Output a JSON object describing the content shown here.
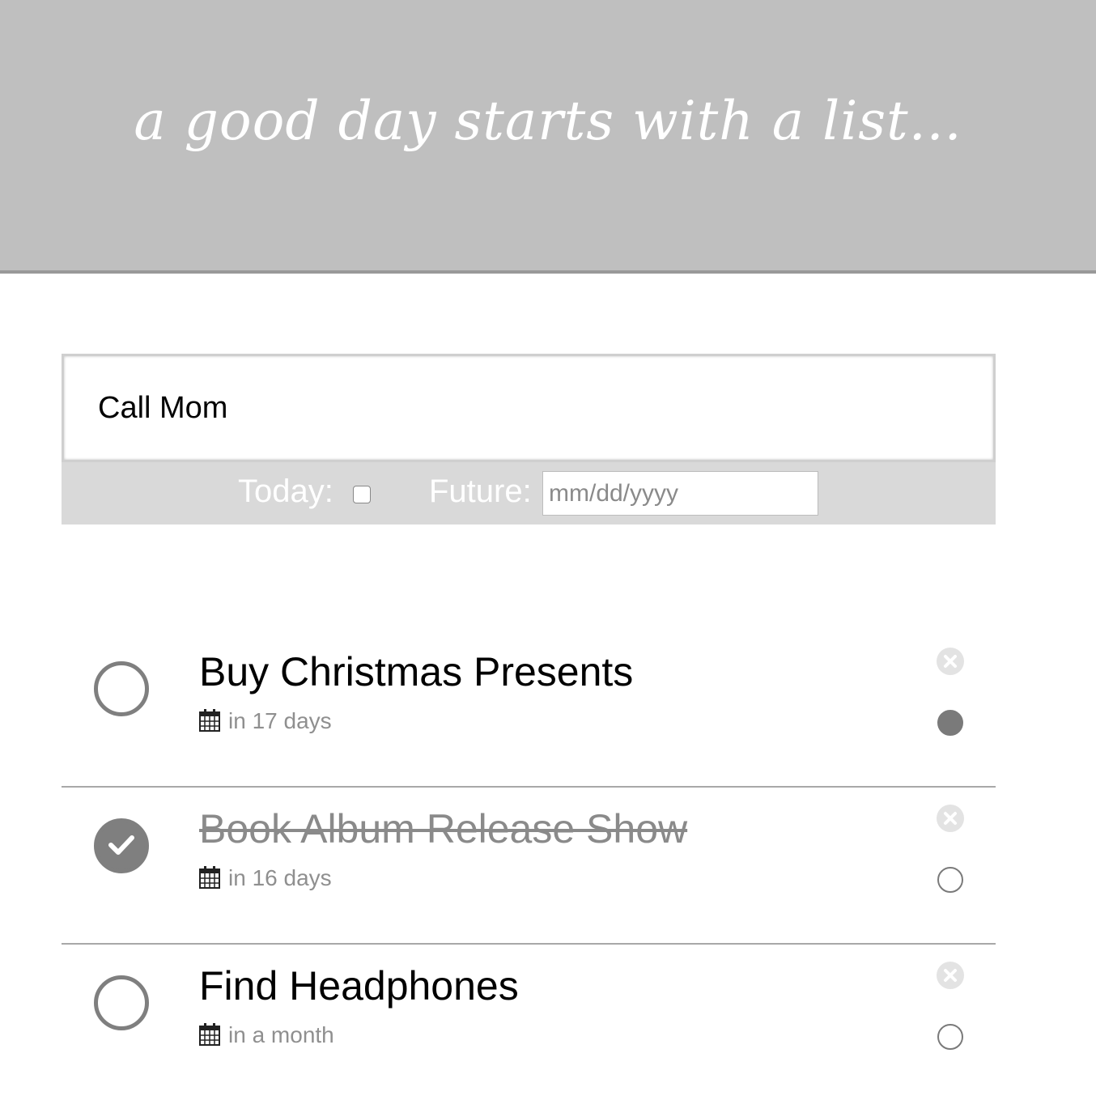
{
  "header": {
    "tagline": "a good day starts with a list..."
  },
  "entry": {
    "value": "Call Mom"
  },
  "options": {
    "today_label": "Today:",
    "today_checked": false,
    "future_label": "Future:",
    "date_placeholder": "mm/dd/yyyy"
  },
  "tasks": [
    {
      "title": "Buy Christmas Presents",
      "due": "in 17 days",
      "completed": false,
      "priority": true
    },
    {
      "title": "Book Album Release Show",
      "due": "in 16 days",
      "completed": true,
      "priority": false
    },
    {
      "title": "Find Headphones",
      "due": "in a month",
      "completed": false,
      "priority": false
    }
  ],
  "icons": {
    "complete": "checkmark-icon",
    "calendar": "calendar-icon",
    "delete": "close-circle-icon",
    "priority": "priority-dot-icon"
  },
  "colors": {
    "header_bg": "#bfbfbf",
    "header_border": "#999999",
    "options_bg": "#d9d9d9",
    "accent_gray": "#7f7f7f",
    "muted_text": "#8f8f8f"
  }
}
